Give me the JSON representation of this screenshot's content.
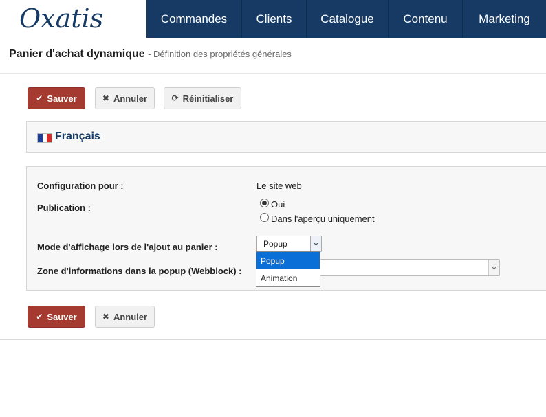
{
  "header": {
    "logo_text": "Oxatis",
    "nav": [
      "Commandes",
      "Clients",
      "Catalogue",
      "Contenu",
      "Marketing"
    ]
  },
  "page": {
    "title": "Panier d'achat dynamique",
    "subtitle": "- Définition des propriétés générales"
  },
  "toolbar_top": {
    "save": "Sauver",
    "cancel": "Annuler",
    "reset": "Réinitialiser"
  },
  "language": {
    "label": "Français",
    "flag_colors": [
      "#1f3f9a",
      "#ffffff",
      "#d62b2b"
    ]
  },
  "form": {
    "config_label": "Configuration pour :",
    "config_value": "Le site web",
    "publication_label": "Publication :",
    "publication_options": [
      "Oui",
      "Dans l'aperçu uniquement"
    ],
    "publication_selected": "Oui",
    "mode_label": "Mode d'affichage lors de l'ajout au panier :",
    "mode_value": "Popup",
    "mode_options": [
      "Popup",
      "Animation"
    ],
    "zone_label": "Zone d'informations dans la popup (Webblock) :",
    "zone_value": ""
  },
  "toolbar_bottom": {
    "save": "Sauver",
    "cancel": "Annuler"
  },
  "colors": {
    "nav_bg": "#163a63",
    "save_bg": "#a53a30",
    "dropdown_selected": "#0a6fd6"
  }
}
